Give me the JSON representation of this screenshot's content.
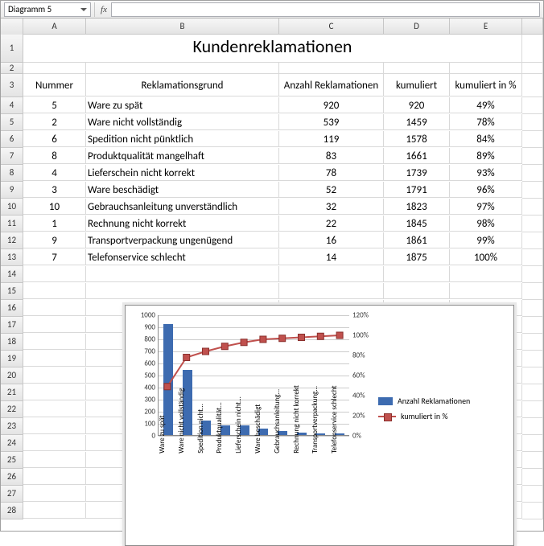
{
  "formula_bar": {
    "name_box": "Diagramm 5",
    "fx_label": "fx",
    "formula": ""
  },
  "columns": [
    "A",
    "B",
    "C",
    "D",
    "E"
  ],
  "title": "Kundenreklamationen",
  "headers": {
    "a": "Nummer",
    "b": "Reklamationsgrund",
    "c": "Anzahl Reklamationen",
    "d": "kumuliert",
    "e": "kumuliert in %"
  },
  "rows": [
    {
      "num": "5",
      "reason": "Ware zu spät",
      "count": "920",
      "cum": "920",
      "pct": "49%"
    },
    {
      "num": "2",
      "reason": "Ware nicht vollständig",
      "count": "539",
      "cum": "1459",
      "pct": "78%"
    },
    {
      "num": "6",
      "reason": "Spedition nicht pünktlich",
      "count": "119",
      "cum": "1578",
      "pct": "84%"
    },
    {
      "num": "8",
      "reason": "Produktqualität mangelhaft",
      "count": "83",
      "cum": "1661",
      "pct": "89%"
    },
    {
      "num": "4",
      "reason": "Lieferschein nicht korrekt",
      "count": "78",
      "cum": "1739",
      "pct": "93%"
    },
    {
      "num": "3",
      "reason": "Ware beschädigt",
      "count": "52",
      "cum": "1791",
      "pct": "96%"
    },
    {
      "num": "10",
      "reason": "Gebrauchsanleitung unverständlich",
      "count": "32",
      "cum": "1823",
      "pct": "97%"
    },
    {
      "num": "1",
      "reason": "Rechnung nicht korrekt",
      "count": "22",
      "cum": "1845",
      "pct": "98%"
    },
    {
      "num": "9",
      "reason": "Transportverpackung ungenügend",
      "count": "16",
      "cum": "1861",
      "pct": "99%"
    },
    {
      "num": "7",
      "reason": "Telefonservice schlecht",
      "count": "14",
      "cum": "1875",
      "pct": "100%"
    }
  ],
  "legend": {
    "series1": "Anzahl Reklamationen",
    "series2": "kumuliert in %"
  },
  "chart_data": {
    "type": "bar+line",
    "categories": [
      "Ware zu spät",
      "Ware nicht vollständig",
      "Spedition nicht...",
      "Produktqualität...",
      "Lieferschein nicht...",
      "Ware beschädigt",
      "Gebrauchsanleitung...",
      "Rechnung nicht korrekt",
      "Transportverpackung...",
      "Telefonservice schlecht"
    ],
    "series": [
      {
        "name": "Anzahl Reklamationen",
        "axis": "left",
        "type": "bar",
        "values": [
          920,
          539,
          119,
          83,
          78,
          52,
          32,
          22,
          16,
          14
        ]
      },
      {
        "name": "kumuliert in %",
        "axis": "right",
        "type": "line",
        "values": [
          49,
          78,
          84,
          89,
          93,
          96,
          97,
          98,
          99,
          100
        ]
      }
    ],
    "y_left": {
      "min": 0,
      "max": 1000,
      "step": 100,
      "ticks": [
        "0",
        "100",
        "200",
        "300",
        "400",
        "500",
        "600",
        "700",
        "800",
        "900",
        "1000"
      ]
    },
    "y_right": {
      "min": 0,
      "max": 120,
      "step": 20,
      "ticks": [
        "0%",
        "20%",
        "40%",
        "60%",
        "80%",
        "100%",
        "120%"
      ]
    }
  }
}
